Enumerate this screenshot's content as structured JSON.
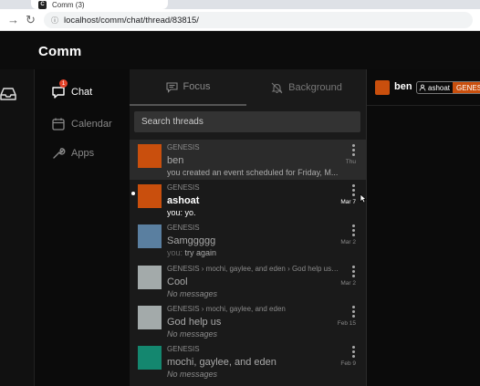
{
  "browser": {
    "tab_title": "Comm (3)",
    "tab_favicon": "C",
    "url": "localhost/comm/chat/thread/83815/"
  },
  "app": {
    "logo": "Comm"
  },
  "nav": {
    "chat_label": "Chat",
    "chat_badge": "1",
    "calendar_label": "Calendar",
    "apps_label": "Apps"
  },
  "thread_tabs": {
    "focus": "Focus",
    "background": "Background"
  },
  "search": {
    "placeholder": "Search threads"
  },
  "threads": [
    {
      "community": "GENESIS",
      "name": "ben",
      "preview": "you created an event scheduled for Friday, M...",
      "time": "Thu",
      "color": "#c94f0d",
      "selected": true,
      "unread": false
    },
    {
      "community": "GENESIS",
      "name": "ashoat",
      "preview": "you: yo.",
      "time": "Mar 7",
      "color": "#c94f0d",
      "selected": false,
      "unread": true
    },
    {
      "community": "GENESIS",
      "name": "Samggggg",
      "sender": "you:",
      "preview": " try again",
      "time": "Mar 2",
      "color": "#5a7fa0",
      "selected": false,
      "unread": false
    },
    {
      "community": "GENESIS › mochi, gaylee, and eden › God help us › W",
      "name": "Cool",
      "preview": "No messages",
      "empty": true,
      "time": "Mar 2",
      "color": "#a3aaaa",
      "selected": false,
      "unread": false
    },
    {
      "community": "GENESIS › mochi, gaylee, and eden",
      "name": "God help us",
      "preview": "No messages",
      "empty": true,
      "time": "Feb 15",
      "color": "#a3aaaa",
      "selected": false,
      "unread": false
    },
    {
      "community": "GENESIS",
      "name": "mochi, gaylee, and eden",
      "preview": "No messages",
      "empty": true,
      "time": "Feb 9",
      "color": "#14876f",
      "selected": false,
      "unread": false
    }
  ],
  "chat_header": {
    "name": "ben",
    "member": "ashoat",
    "community": "GENESIS",
    "color": "#c94f0d"
  }
}
